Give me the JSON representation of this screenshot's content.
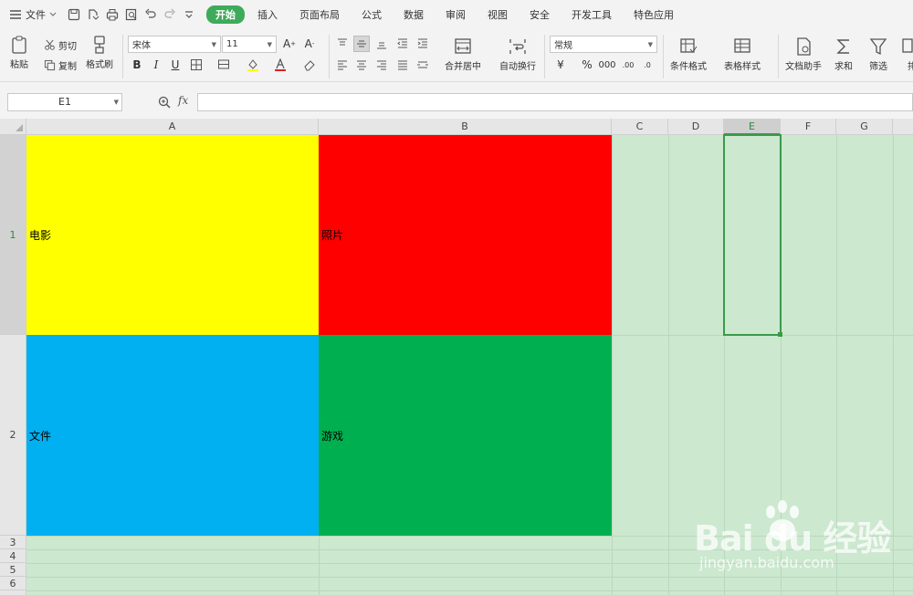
{
  "menubar": {
    "file_label": "文件",
    "tabs": [
      {
        "label": "开始",
        "active": true
      },
      {
        "label": "插入",
        "active": false
      },
      {
        "label": "页面布局",
        "active": false
      },
      {
        "label": "公式",
        "active": false
      },
      {
        "label": "数据",
        "active": false
      },
      {
        "label": "审阅",
        "active": false
      },
      {
        "label": "视图",
        "active": false
      },
      {
        "label": "安全",
        "active": false
      },
      {
        "label": "开发工具",
        "active": false
      },
      {
        "label": "特色应用",
        "active": false
      }
    ]
  },
  "ribbon": {
    "paste_label": "粘贴",
    "cut_label": "剪切",
    "copy_label": "复制",
    "format_painter_label": "格式刷",
    "font_name": "宋体",
    "font_size": "11",
    "merge_label": "合并居中",
    "wrap_label": "自动换行",
    "number_format": "常规",
    "cond_format_label": "条件格式",
    "table_style_label": "表格样式",
    "doc_helper_label": "文档助手",
    "sum_label": "求和",
    "filter_label": "筛选",
    "sort_label": "排"
  },
  "formula_bar": {
    "name_box": "E1",
    "fx_label": "fx",
    "formula": ""
  },
  "sheet": {
    "columns": [
      "A",
      "B",
      "C",
      "D",
      "E",
      "F",
      "G"
    ],
    "selected_column": "E",
    "rows": [
      "1",
      "2",
      "3",
      "4",
      "5",
      "6"
    ],
    "cells": {
      "A1": {
        "text": "电影",
        "fill": "#ffff00"
      },
      "B1": {
        "text": "照片",
        "fill": "#ff0000"
      },
      "A2": {
        "text": "文件",
        "fill": "#00b0f0"
      },
      "B2": {
        "text": "游戏",
        "fill": "#00b050"
      }
    },
    "selected_cell": "E1",
    "grid_background": "#cce8cf",
    "accent": "#3fab5a"
  },
  "watermark": {
    "logo": "Bai du 经验",
    "url": "jingyan.baidu.com"
  }
}
